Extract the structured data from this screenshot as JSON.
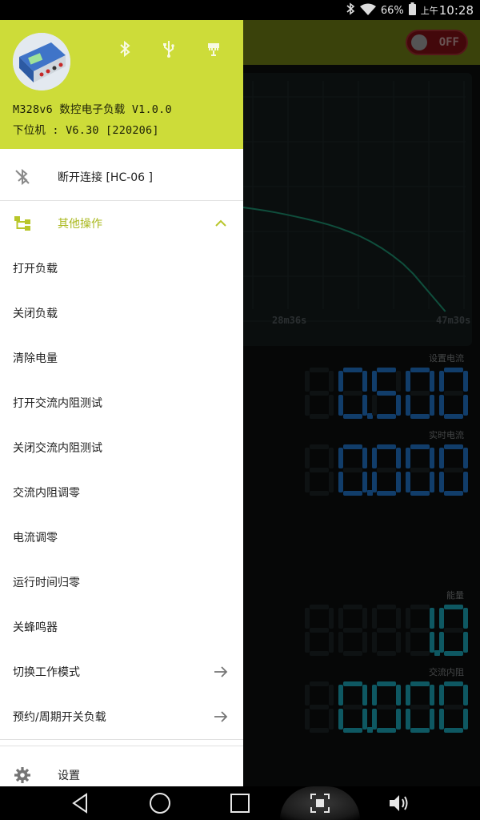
{
  "status_bar": {
    "battery": "66%",
    "ampm": "上午",
    "time": "10:28"
  },
  "app": {
    "power_toggle": "OFF",
    "chart_data": {
      "type": "line",
      "x_ticks": [
        "28m36s",
        "47m30s"
      ],
      "series": [
        {
          "values": [
            [
              0,
              0.0
            ],
            [
              0.05,
              0.015
            ],
            [
              0.1,
              0.03
            ],
            [
              0.15,
              0.048
            ],
            [
              0.2,
              0.068
            ],
            [
              0.25,
              0.09
            ],
            [
              0.3,
              0.112
            ],
            [
              0.35,
              0.138
            ],
            [
              0.4,
              0.165
            ],
            [
              0.45,
              0.198
            ],
            [
              0.5,
              0.235
            ],
            [
              0.55,
              0.278
            ],
            [
              0.6,
              0.33
            ],
            [
              0.65,
              0.39
            ],
            [
              0.7,
              0.46
            ],
            [
              0.75,
              0.54
            ],
            [
              0.8,
              0.64
            ],
            [
              0.85,
              0.76
            ],
            [
              0.9,
              0.88
            ],
            [
              0.95,
              1.0
            ]
          ],
          "color": "#1c8f6e"
        }
      ]
    },
    "readouts": [
      {
        "label": "设置电流",
        "value": "0.500",
        "color": "#1f6fc2"
      },
      {
        "label": "实时电流",
        "value": "0.000",
        "color": "#1f6fc2"
      },
      {
        "label": "能量",
        "value": "1.0",
        "color": "#1aa1b3"
      },
      {
        "label": "交流内阻",
        "value": "0.000",
        "color": "#1aa1b3"
      }
    ]
  },
  "drawer": {
    "title": "M328v6 数控电子负载 V1.0.0",
    "firmware": "下位机 : V6.30 [220206]",
    "accent": "#cddc39",
    "disconnect": "断开连接 [HC-06 ]",
    "other_ops": "其他操作",
    "items": [
      "打开负载",
      "关闭负载",
      "清除电量",
      "打开交流内阻测试",
      "关闭交流内阻测试",
      "交流内阻调零",
      "电流调零",
      "运行时间归零",
      "关蜂鸣器",
      "切换工作模式",
      "预约/周期开关负载"
    ],
    "settings": "设置"
  }
}
